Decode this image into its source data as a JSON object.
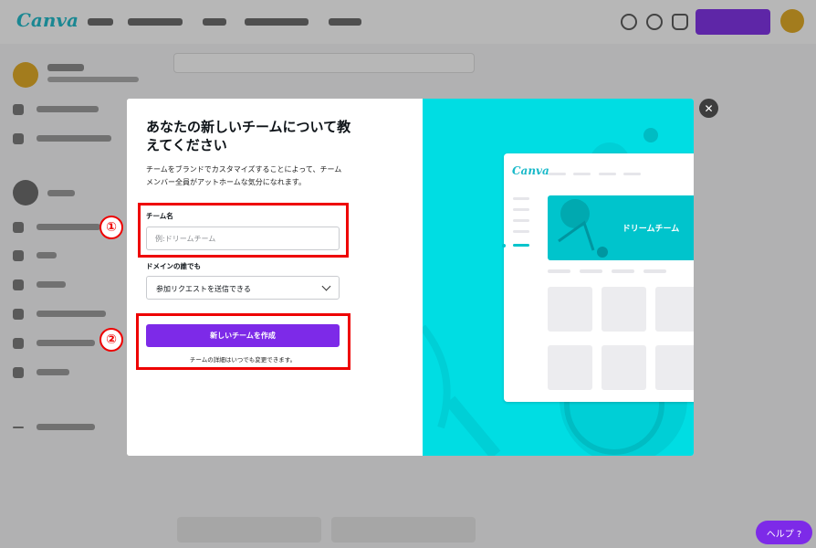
{
  "background": {
    "logo": "Canva",
    "help_button": "ヘルプ ?"
  },
  "modal": {
    "title": "あなたの新しいチームについて教えてください",
    "description": "チームをブランドでカスタマイズすることによって、チームメンバー全員がアットホームな気分になれます。",
    "team_name_label": "チーム名",
    "team_name_placeholder": "例:ドリームチーム",
    "team_name_value": "",
    "domain_label": "ドメインの誰でも",
    "domain_select_value": "参加リクエストを送信できる",
    "create_button": "新しいチームを作成",
    "note": "チームの詳細はいつでも変更できます。",
    "close_icon": "✕"
  },
  "preview": {
    "logo": "Canva",
    "banner_text": "ドリームチーム"
  },
  "annotations": {
    "marker1": "①",
    "marker2": "②",
    "color": "#ee0000"
  },
  "colors": {
    "accent": "#7d2ae8",
    "teal": "#00dde3",
    "teal_dark": "#00c4cc"
  }
}
